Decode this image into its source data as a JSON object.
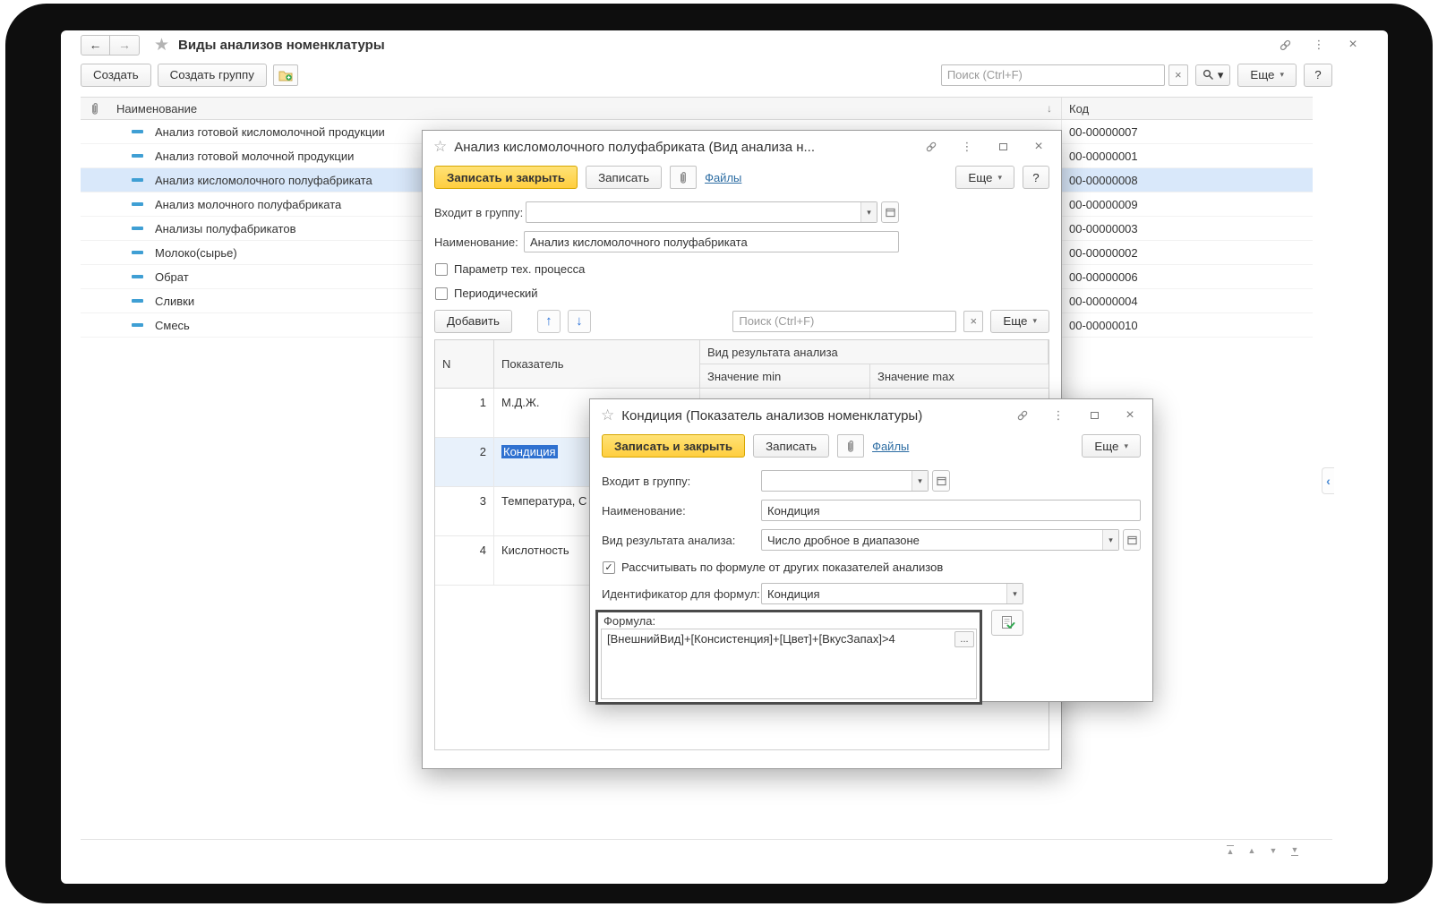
{
  "colors": {
    "accent_yellow": "#ffd54a",
    "selection_blue": "#2f71d0",
    "row_highlight": "#d9e8fa",
    "link_blue": "#2d6da3",
    "element_dash": "#3f9fd4"
  },
  "icons": {
    "back": "←",
    "forward": "→",
    "favorite_star": "★",
    "dialog_star": "☆",
    "menu_dots": "⋮",
    "close": "×",
    "clear": "×",
    "dropdown": "▾",
    "sort_desc": "↓",
    "move_up": "↑",
    "move_down": "↓",
    "check": "✓",
    "collapse_left": "‹",
    "scroll_up": "▲",
    "scroll_down": "▼"
  },
  "window": {
    "title": "Виды анализов номенклатуры",
    "toolbar": {
      "create": "Создать",
      "create_group": "Создать группу",
      "search_placeholder": "Поиск (Ctrl+F)",
      "more": "Еще",
      "help": "?"
    },
    "table": {
      "columns": {
        "name": "Наименование",
        "code": "Код"
      },
      "selected_index": 2,
      "rows": [
        {
          "name": "Анализ готовой кисломолочной продукции",
          "code": "00-00000007"
        },
        {
          "name": "Анализ готовой молочной продукции",
          "code": "00-00000001"
        },
        {
          "name": "Анализ кисломолочного полуфабриката",
          "code": "00-00000008"
        },
        {
          "name": "Анализ молочного полуфабриката",
          "code": "00-00000009"
        },
        {
          "name": "Анализы полуфабрикатов",
          "code": "00-00000003"
        },
        {
          "name": "Молоко(сырье)",
          "code": "00-00000002"
        },
        {
          "name": "Обрат",
          "code": "00-00000006"
        },
        {
          "name": "Сливки",
          "code": "00-00000004"
        },
        {
          "name": "Смесь",
          "code": "00-00000010"
        }
      ]
    }
  },
  "dialog_analysis": {
    "title": "Анализ кисломолочного полуфабриката (Вид анализа н...",
    "buttons": {
      "save_close": "Записать и закрыть",
      "save": "Записать",
      "files": "Файлы",
      "more": "Еще",
      "help": "?",
      "add": "Добавить"
    },
    "search_placeholder": "Поиск (Ctrl+F)",
    "fields": {
      "group_label": "Входит в группу:",
      "name_label": "Наименование:",
      "name_value": "Анализ кисломолочного полуфабриката",
      "checkbox_process": "Параметр тех. процесса",
      "checkbox_periodic": "Периодический"
    },
    "table": {
      "columns": {
        "n": "N",
        "indicator": "Показатель",
        "result": "Вид результата анализа",
        "min": "Значение min",
        "max": "Значение max"
      },
      "selected_index": 1,
      "rows": [
        {
          "n": "1",
          "indicator": "М.Д.Ж."
        },
        {
          "n": "2",
          "indicator": "Кондиция"
        },
        {
          "n": "3",
          "indicator": "Температура, С"
        },
        {
          "n": "4",
          "indicator": "Кислотность"
        }
      ]
    }
  },
  "dialog_indicator": {
    "title": "Кондиция (Показатель анализов номенклатуры)",
    "buttons": {
      "save_close": "Записать и закрыть",
      "save": "Записать",
      "files": "Файлы",
      "more": "Еще"
    },
    "fields": {
      "group_label": "Входит в группу:",
      "name_label": "Наименование:",
      "name_value": "Кондиция",
      "result_label": "Вид результата анализа:",
      "result_value": "Число дробное в диапазоне",
      "checkbox_formula": "Рассчитывать по формуле от других показателей анализов",
      "identifier_label": "Идентификатор для формул:",
      "identifier_value": "Кондиция",
      "formula_label": "Формула:",
      "formula_value": "[ВнешнийВид]+[Консистенция]+[Цвет]+[ВкусЗапах]>4",
      "ellipsis": "..."
    }
  }
}
